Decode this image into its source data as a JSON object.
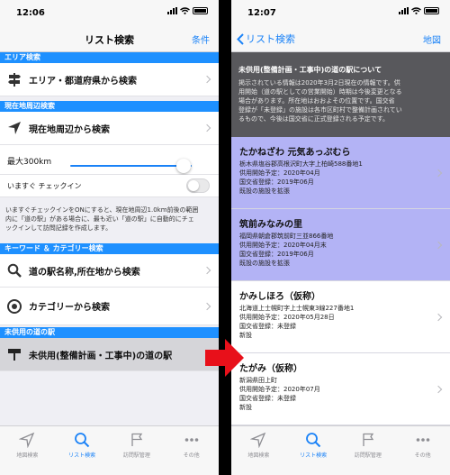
{
  "left": {
    "status": {
      "time": "12:06"
    },
    "nav": {
      "title": "リスト検索",
      "right": "条件"
    },
    "sections": {
      "area": "エリア検索",
      "nearby": "現在地周辺検索",
      "keyword": "キーワード ＆ カテゴリー検索",
      "unopened": "未供用の道の駅"
    },
    "rows": {
      "area": "エリア・都道府県から検索",
      "nearby": "現在地周辺から検索",
      "max_label": "最大300km",
      "checkin_label": "いますぐ チェックイン",
      "name_search": "道の駅名称,所在地から検索",
      "category": "カテゴリーから検索",
      "unopened": "未供用(整備計画・工事中)の道の駅"
    },
    "slider_value": 0.93,
    "note": [
      "いますぐチェックインをONにすると、現在地周辺1.0km前後の範囲",
      "内に「道の駅」がある場合に、最も近い「道の駅」に自動的にチェ",
      "ックインして訪問記録を作成します。"
    ]
  },
  "right": {
    "status": {
      "time": "12:07"
    },
    "nav": {
      "back": "リスト検索",
      "right": "地図"
    },
    "info": {
      "title": "未供用(整備計画・工事中)の道の駅について",
      "lines": [
        "掲示されている情報は2020年3月2日現在の情報です。供",
        "用開始（道の駅としての営業開始）時期は今後変更となる",
        "場合があります。所在地はおおよその位置です。国交省",
        "登録が「未登録」の施設は各市区町村で整備計画されてい",
        "るもので、今後は国交省に正式登録される予定です。"
      ]
    },
    "stations": [
      {
        "name": "たかねざわ 元気あっぷむら",
        "lines": [
          "栃木県塩谷郡高根沢町大字上柏崎588番地1",
          "供用開始予定：2020年04月",
          "国交省登録：2019年06月",
          "既設の施設を拡張"
        ]
      },
      {
        "name": "筑前みなみの里",
        "lines": [
          "福岡県朝倉郡筑前町三並866番地",
          "供用開始予定：2020年04月末",
          "国交省登録：2019年06月",
          "既設の施設を拡張"
        ]
      },
      {
        "name": "かみしほろ（仮称）",
        "lines": [
          "北海道上士幌町字上士幌東3線227番地1",
          "供用開始予定：2020年05月28日",
          "国交省登録：未登録",
          "新設"
        ]
      },
      {
        "name": "たがみ（仮称）",
        "lines": [
          "新潟県田上町",
          "供用開始予定：2020年07月",
          "国交省登録：未登録",
          "新設"
        ]
      }
    ]
  },
  "tabs": [
    "地図検索",
    "リスト検索",
    "訪問駅管理",
    "その他"
  ],
  "colors": {
    "accent": "#1a82f7",
    "section": "#1e90ff",
    "registered_bg": "#b3b3f5",
    "info_bg": "#58585c",
    "arrow": "#e8101a"
  }
}
